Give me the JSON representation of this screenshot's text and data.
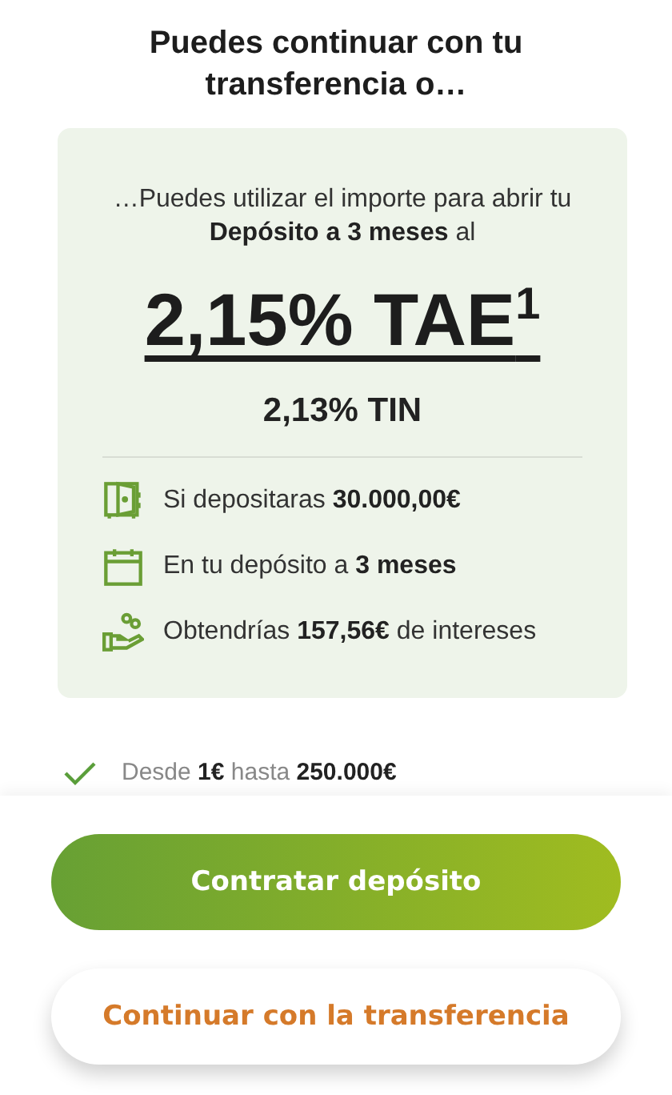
{
  "title": "Puedes continuar con tu transferencia o…",
  "offer": {
    "intro": "…Puedes utilizar el importe para abrir tu **Depósito a 3 meses** al",
    "tae": "2,15% TAE$^{1}$",
    "tin": "2,13% TIN",
    "details": [
      {
        "kind": "safe",
        "text": "Si depositaras **30.000,00€**"
      },
      {
        "kind": "calendar",
        "text": "En tu depósito a **3 meses**"
      },
      {
        "kind": "coins",
        "text": "Obtendrías **157,56€** de intereses"
      }
    ]
  },
  "limits": "Desde **1€** hasta **250.000€**",
  "buttons": [
    {
      "kind": "primary",
      "label": "Contratar depósito"
    },
    {
      "kind": "secondary",
      "label": "Continuar con la transferencia"
    }
  ]
}
